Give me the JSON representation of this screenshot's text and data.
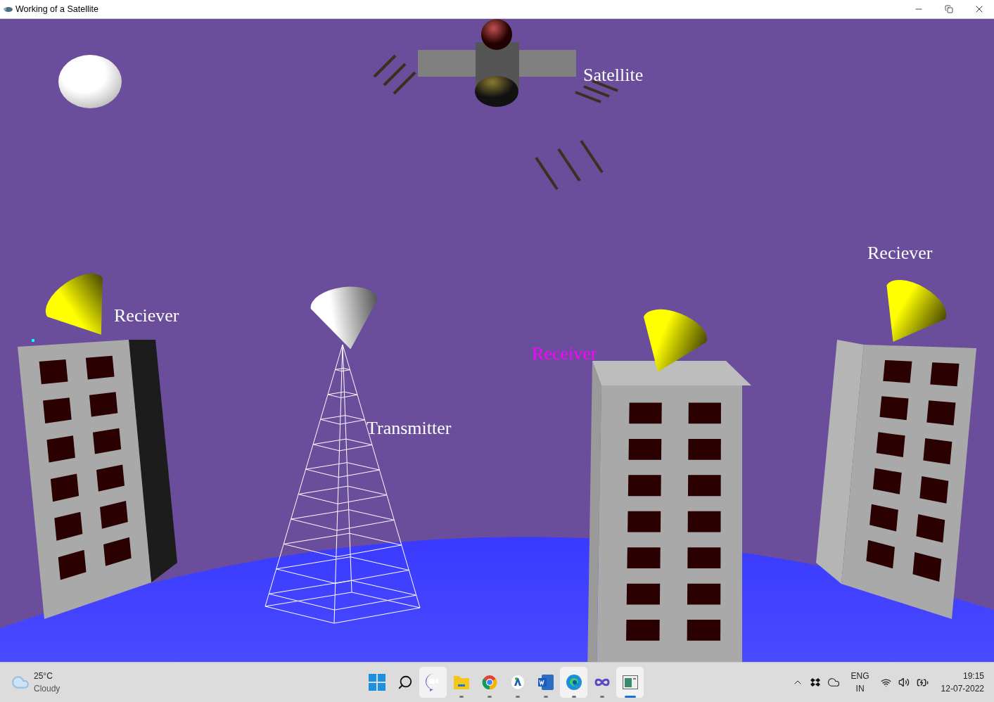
{
  "window": {
    "title": "Working of a Satellite"
  },
  "scene": {
    "labels": [
      {
        "kind": "satellite",
        "text": "Satellite",
        "color": "#ffffff"
      },
      {
        "kind": "left",
        "text": "Reciever",
        "color": "#ffffff"
      },
      {
        "kind": "right",
        "text": "Reciever",
        "color": "#ffffff"
      },
      {
        "kind": "middle",
        "text": "Receiver",
        "color": "#ff00ff"
      },
      {
        "kind": "tower",
        "text": "Transmitter",
        "color": "#ffffff"
      }
    ]
  },
  "taskbar": {
    "weather": {
      "temperature": "25°C",
      "condition": "Cloudy"
    },
    "apps": [
      {
        "kind": "start",
        "running": false,
        "highlighted": false,
        "selected": false
      },
      {
        "kind": "search",
        "running": false,
        "highlighted": false,
        "selected": false
      },
      {
        "kind": "chat",
        "running": false,
        "highlighted": true,
        "selected": false
      },
      {
        "kind": "files",
        "running": true,
        "highlighted": false,
        "selected": false
      },
      {
        "kind": "chrome",
        "running": true,
        "highlighted": false,
        "selected": false
      },
      {
        "kind": "badge",
        "running": true,
        "highlighted": false,
        "selected": false
      },
      {
        "kind": "word",
        "running": true,
        "highlighted": false,
        "selected": false
      },
      {
        "kind": "edge",
        "running": true,
        "highlighted": true,
        "selected": false
      },
      {
        "kind": "infinity",
        "running": true,
        "highlighted": false,
        "selected": false
      },
      {
        "kind": "window",
        "running": true,
        "highlighted": true,
        "selected": true
      }
    ],
    "language": {
      "code": "ENG",
      "region": "IN"
    },
    "time": "19:15",
    "date": "12-07-2022"
  }
}
